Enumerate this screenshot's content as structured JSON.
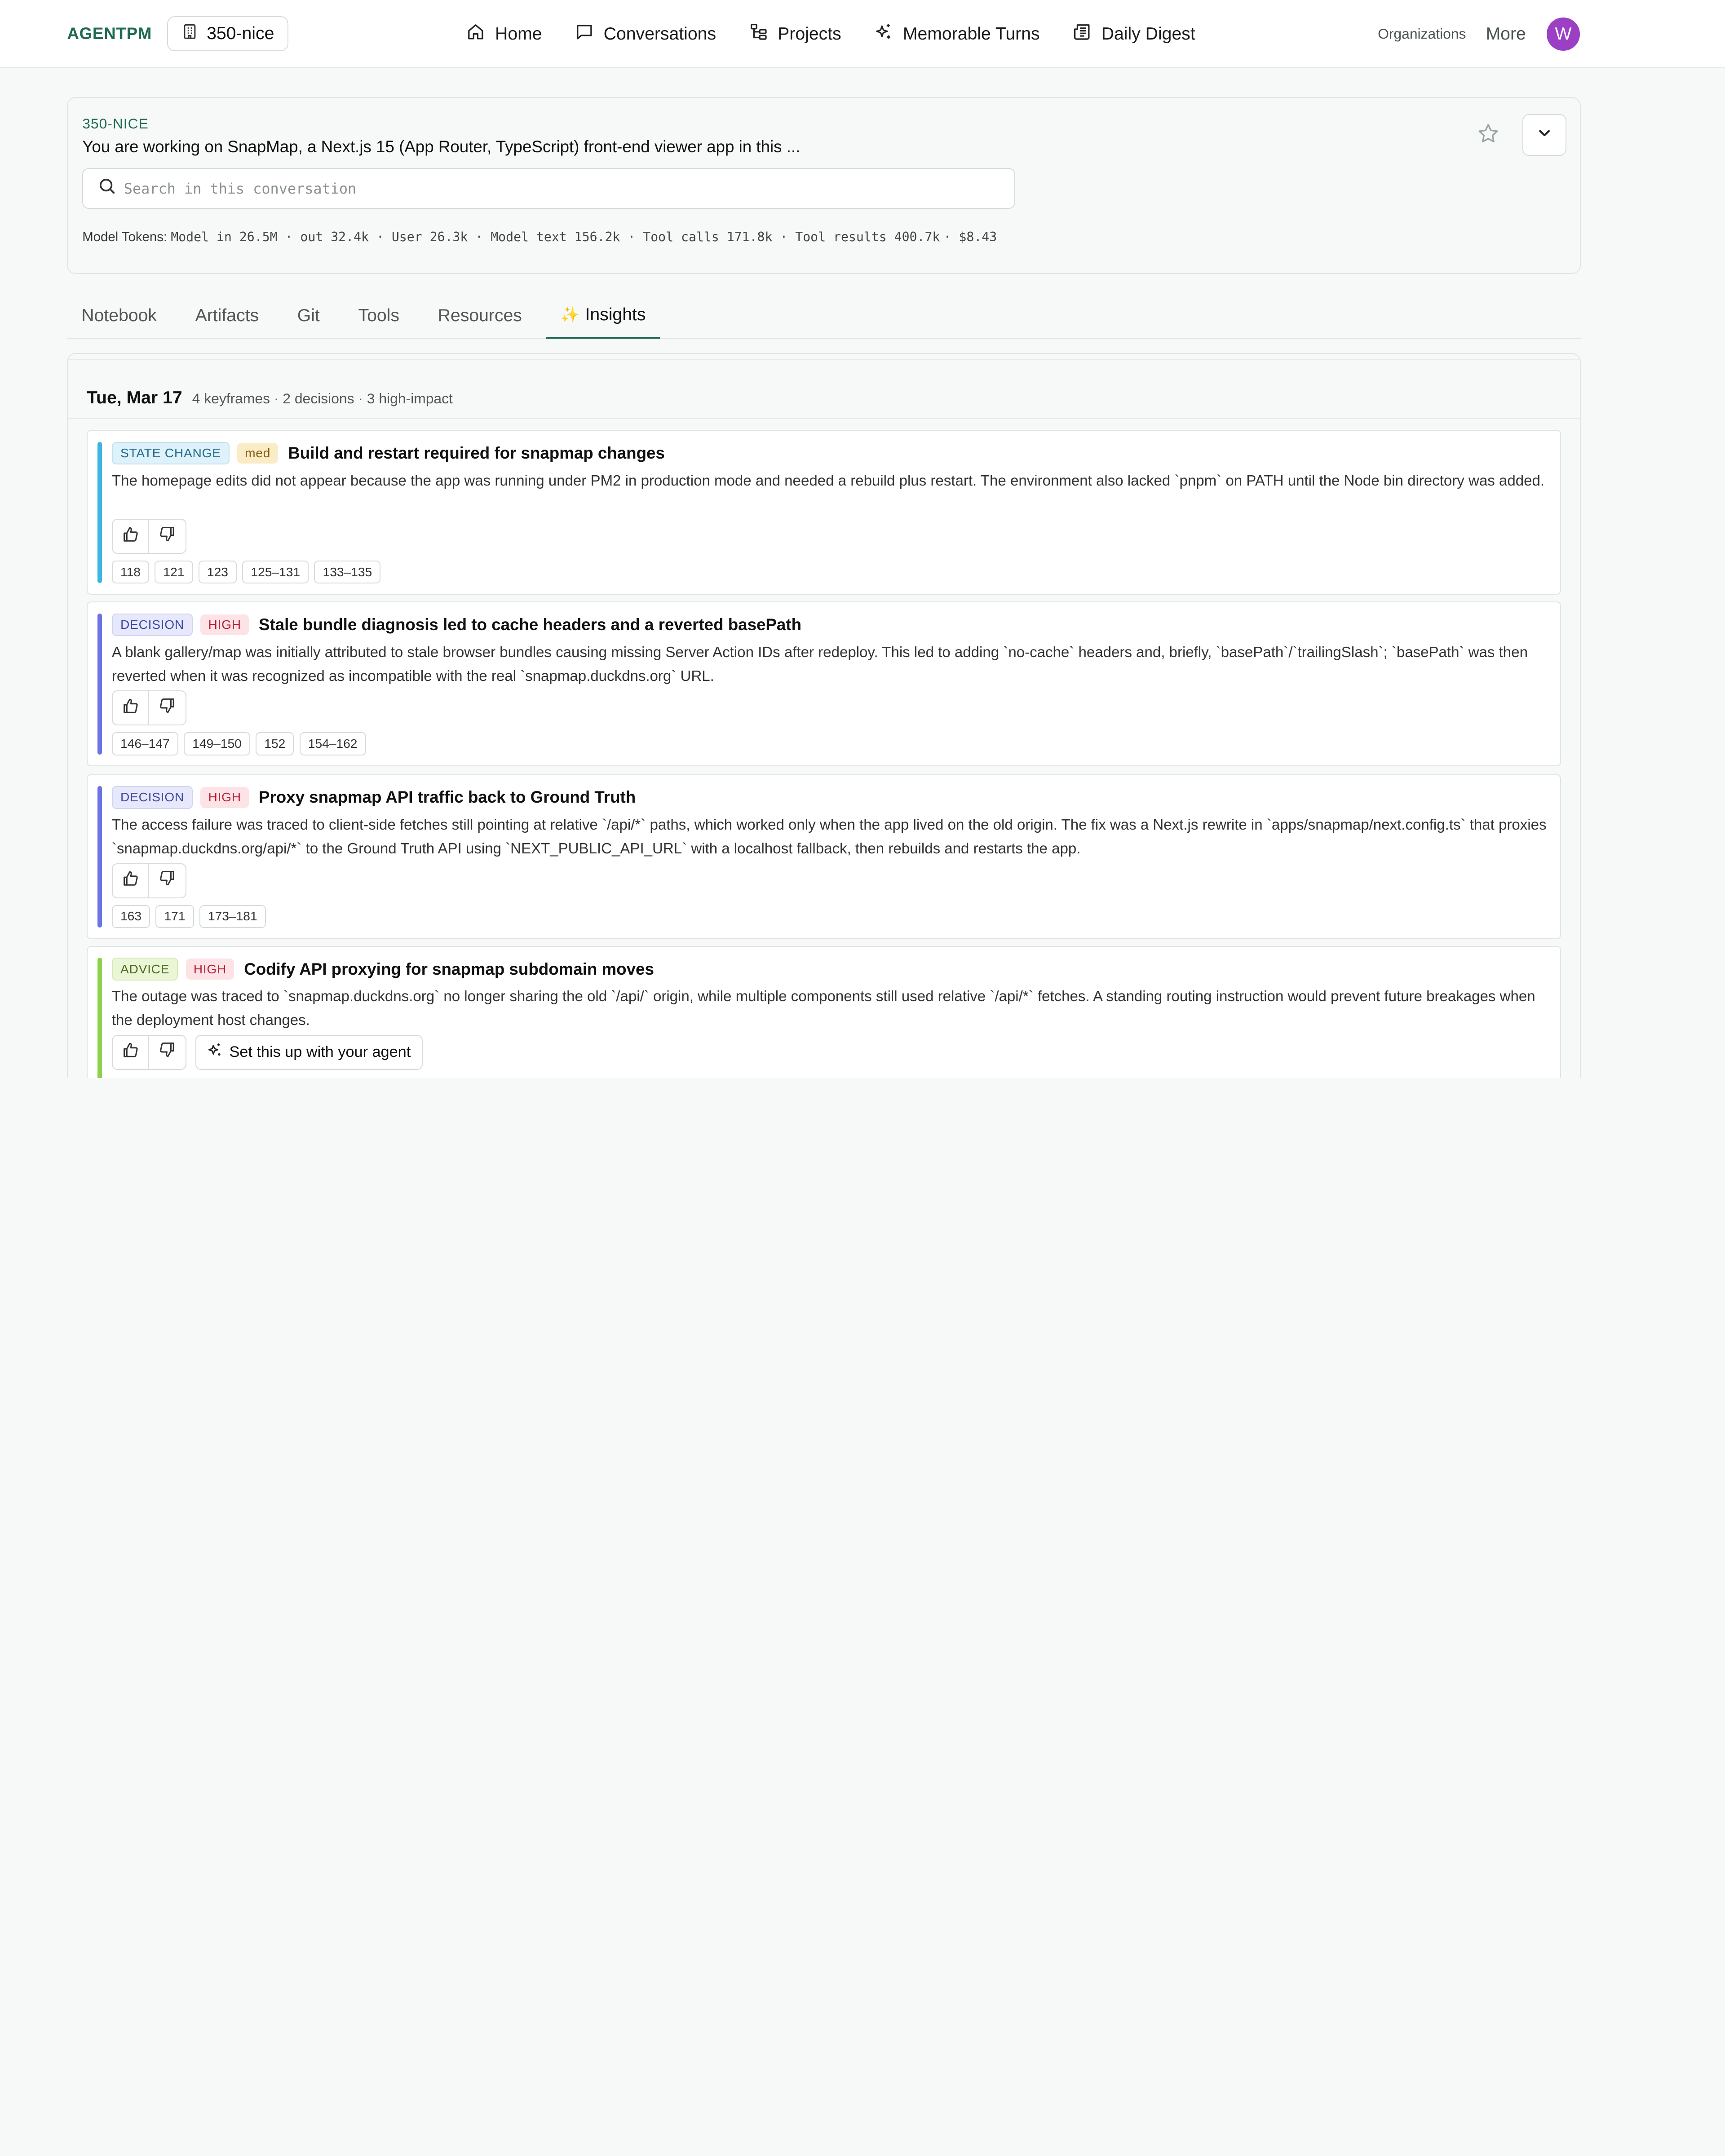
{
  "nav": {
    "brand": "AGENTPM",
    "workspace": "350-nice",
    "links": {
      "home": "Home",
      "conversations": "Conversations",
      "projects": "Projects",
      "memorable": "Memorable Turns",
      "digest": "Daily Digest"
    },
    "organizations": "Organizations",
    "more": "More",
    "avatar_initial": "W"
  },
  "conversation": {
    "id": "350-NICE",
    "title": "You are working on SnapMap, a Next.js 15 (App Router, TypeScript) front-end viewer app in this ...",
    "search_placeholder": "Search in this conversation",
    "tokens_label": "Model Tokens:",
    "tokens_value": "Model in 26.5M · out 32.4k · User 26.3k · Model text 156.2k · Tool calls 171.8k · Tool results 400.7k",
    "cost": "· $8.43"
  },
  "tabs": {
    "notebook": "Notebook",
    "artifacts": "Artifacts",
    "git": "Git",
    "tools": "Tools",
    "resources": "Resources",
    "insights": "Insights",
    "insights_icon": "✨"
  },
  "day": {
    "date": "Tue, Mar 17",
    "summary": "4 keyframes · 2 decisions · 3 high-impact"
  },
  "insights": [
    {
      "kind": "STATE CHANGE",
      "impact": "med",
      "title": "Build and restart required for snapmap changes",
      "body": "The homepage edits did not appear because the app was running under PM2 in production mode and needed a rebuild plus restart. The environment also lacked `pnpm` on PATH until the Node bin directory was added.",
      "refs": [
        "118",
        "121",
        "123",
        "125–131",
        "133–135"
      ],
      "accent": "#3bb6e0"
    },
    {
      "kind": "DECISION",
      "impact": "HIGH",
      "title": "Stale bundle diagnosis led to cache headers and a reverted basePath",
      "body": "A blank gallery/map was initially attributed to stale browser bundles causing missing Server Action IDs after redeploy. This led to adding `no-cache` headers and, briefly, `basePath`/`trailingSlash`; `basePath` was then reverted when it was recognized as incompatible with the real `snapmap.duckdns.org` URL.",
      "refs": [
        "146–147",
        "149–150",
        "152",
        "154–162"
      ],
      "accent": "#6b73e6"
    },
    {
      "kind": "DECISION",
      "impact": "HIGH",
      "title": "Proxy snapmap API traffic back to Ground Truth",
      "body": "The access failure was traced to client-side fetches still pointing at relative `/api/*` paths, which worked only when the app lived on the old origin. The fix was a Next.js rewrite in `apps/snapmap/next.config.ts` that proxies `snapmap.duckdns.org/api/*` to the Ground Truth API using `NEXT_PUBLIC_API_URL` with a localhost fallback, then rebuilds and restarts the app.",
      "refs": [
        "163",
        "171",
        "173–181"
      ],
      "accent": "#6b73e6"
    },
    {
      "kind": "ADVICE",
      "impact": "HIGH",
      "title": "Codify API proxying for snapmap subdomain moves",
      "body": "The outage was traced to `snapmap.duckdns.org` no longer sharing the old `/api/` origin, while multiple components still used relative `/api/*` fetches. A standing routing instruction would prevent future breakages when the deployment host changes.",
      "setup_label": "Set this up with your agent",
      "accent": "#8fd14f"
    }
  ]
}
